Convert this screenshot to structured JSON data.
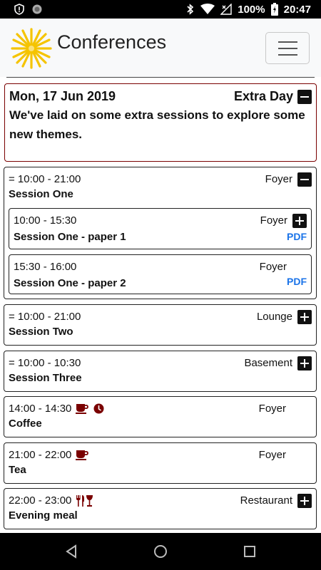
{
  "status": {
    "battery": "100%",
    "time": "20:47"
  },
  "app": {
    "title": "Conferences"
  },
  "day": {
    "date": "Mon, 17 Jun 2019",
    "label": "Extra Day",
    "description": "We've laid on some extra sessions to explore some new themes."
  },
  "sessions": [
    {
      "time": "= 10:00 - 21:00",
      "location": "Foyer",
      "title": "Session One",
      "papers": [
        {
          "time": "10:00 - 15:30",
          "location": "Foyer",
          "title": "Session One - paper 1",
          "link": "PDF"
        },
        {
          "time": "15:30 - 16:00",
          "location": "Foyer",
          "title": "Session One - paper 2",
          "link": "PDF"
        }
      ]
    },
    {
      "time": "= 10:00 - 21:00",
      "location": "Lounge",
      "title": "Session Two"
    },
    {
      "time": "= 10:00 - 10:30",
      "location": "Basement",
      "title": "Session Three"
    },
    {
      "time": "14:00 - 14:30",
      "location": "Foyer",
      "title": "Coffee"
    },
    {
      "time": "21:00 - 22:00",
      "location": "Foyer",
      "title": "Tea"
    },
    {
      "time": "22:00 - 23:00",
      "location": "Restaurant",
      "title": "Evening meal"
    }
  ],
  "icons": {
    "collapse": "minus-square-icon",
    "expand": "plus-square-icon",
    "coffee": "coffee-cup-icon",
    "clock": "clock-icon",
    "meal": "cutlery-wine-icon"
  },
  "colors": {
    "accent": "#7a0000",
    "link": "#1a73e8",
    "logo": "#f5c400"
  }
}
